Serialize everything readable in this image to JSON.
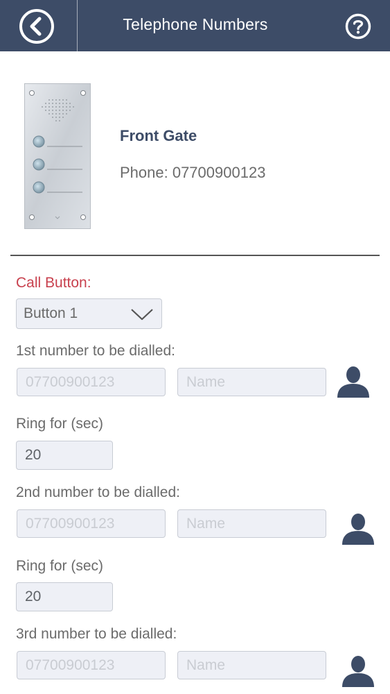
{
  "header": {
    "title": "Telephone Numbers"
  },
  "device": {
    "name": "Front Gate",
    "phone": "Phone: 07700900123"
  },
  "call_button": {
    "label": "Call Button:",
    "selected": "Button 1"
  },
  "entries": [
    {
      "label": "1st number to be dialled:",
      "number_placeholder": "07700900123",
      "name_placeholder": "Name",
      "ring_label": "Ring for (sec)",
      "ring_value": "20"
    },
    {
      "label": "2nd number to be dialled:",
      "number_placeholder": "07700900123",
      "name_placeholder": "Name",
      "ring_label": "Ring for (sec)",
      "ring_value": "20"
    },
    {
      "label": "3rd number to be dialled:",
      "number_placeholder": "07700900123",
      "name_placeholder": "Name"
    }
  ],
  "icons": {
    "back": "back-arrow-circle-icon",
    "help": "help-question-circle-icon",
    "contact": "person-contact-icon",
    "dropdown": "chevron-down-icon"
  },
  "colors": {
    "header_bg": "#3d4c67",
    "accent_label": "#c8414e",
    "device_name": "#3d4c67",
    "field_bg": "#eef0f6"
  }
}
